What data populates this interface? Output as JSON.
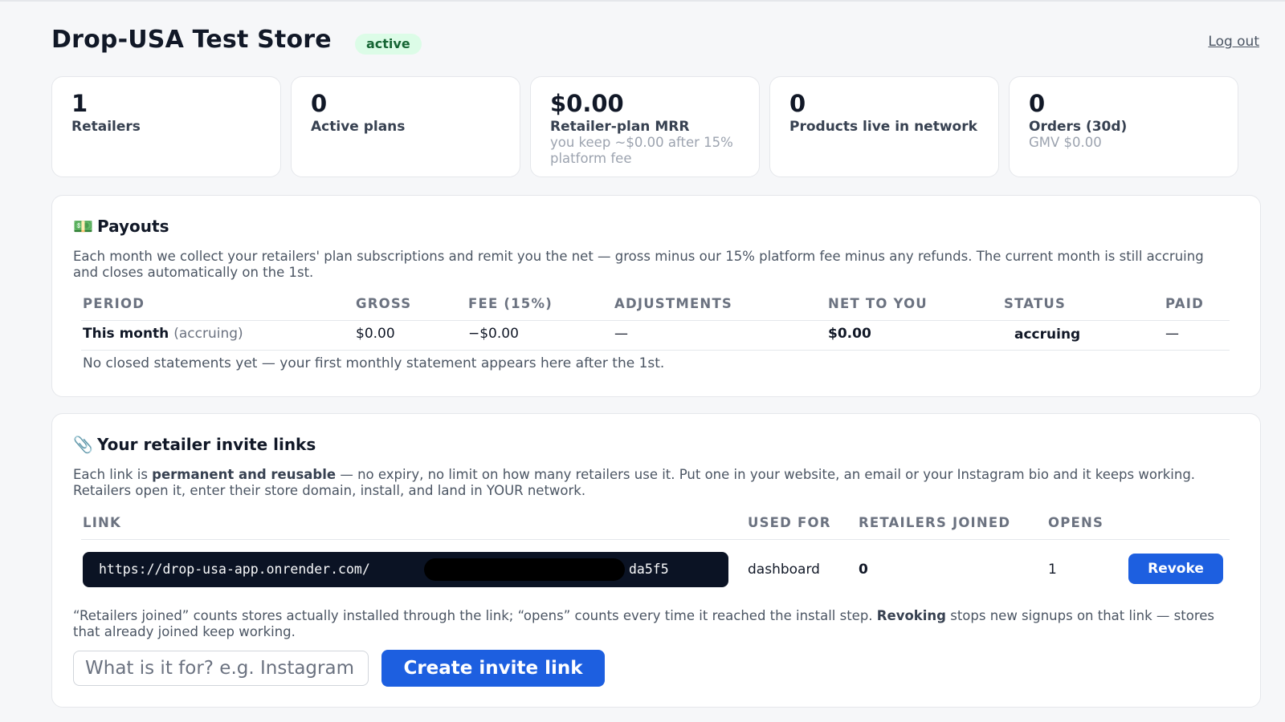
{
  "header": {
    "store_name": "Drop-USA Test Store",
    "status": "active",
    "logout": "Log out"
  },
  "stats": [
    {
      "value": "1",
      "label": "Retailers",
      "sub": ""
    },
    {
      "value": "0",
      "label": "Active plans",
      "sub": ""
    },
    {
      "value": "$0.00",
      "label": "Retailer-plan MRR",
      "sub": "you keep ~$0.00 after 15% platform fee"
    },
    {
      "value": "0",
      "label": "Products live in network",
      "sub": ""
    },
    {
      "value": "0",
      "label": "Orders (30d)",
      "sub": "GMV $0.00"
    }
  ],
  "payouts": {
    "emoji": "💵",
    "title": "Payouts",
    "description": "Each month we collect your retailers' plan subscriptions and remit you the net — gross minus our 15% platform fee minus any refunds. The current month is still accruing and closes automatically on the 1st.",
    "columns": [
      "Period",
      "Gross",
      "Fee (15%)",
      "Adjustments",
      "Net to you",
      "Status",
      "Paid"
    ],
    "row": {
      "period": "This month",
      "period_note": "(accruing)",
      "gross": "$0.00",
      "fee": "−$0.00",
      "adjustments": "—",
      "net": "$0.00",
      "status": "accruing",
      "paid": "—"
    },
    "empty_note": "No closed statements yet — your first monthly statement appears here after the 1st."
  },
  "invites": {
    "emoji": "📎",
    "title": "Your retailer invite links",
    "desc_pre": "Each link is ",
    "desc_bold": "permanent and reusable",
    "desc_post": " — no expiry, no limit on how many retailers use it. Put one in your website, an email or your Instagram bio and it keeps working. Retailers open it, enter their store domain, install, and land in YOUR network.",
    "columns": [
      "Link",
      "Used for",
      "Retailers joined",
      "Opens"
    ],
    "row": {
      "link_start": "https://drop-usa-app.onrender.com/",
      "link_end": "da5f5",
      "used_for": "dashboard",
      "retailers_joined": "0",
      "opens": "1",
      "revoke": "Revoke"
    },
    "note_pre": "“Retailers joined” counts stores actually installed through the link; “opens” counts every time it reached the install step. ",
    "note_bold": "Revoking",
    "note_post": " stops new signups on that link — stores that already joined keep working.",
    "input_placeholder": "What is it for? e.g. Instagram bio",
    "create_button": "Create invite link"
  }
}
